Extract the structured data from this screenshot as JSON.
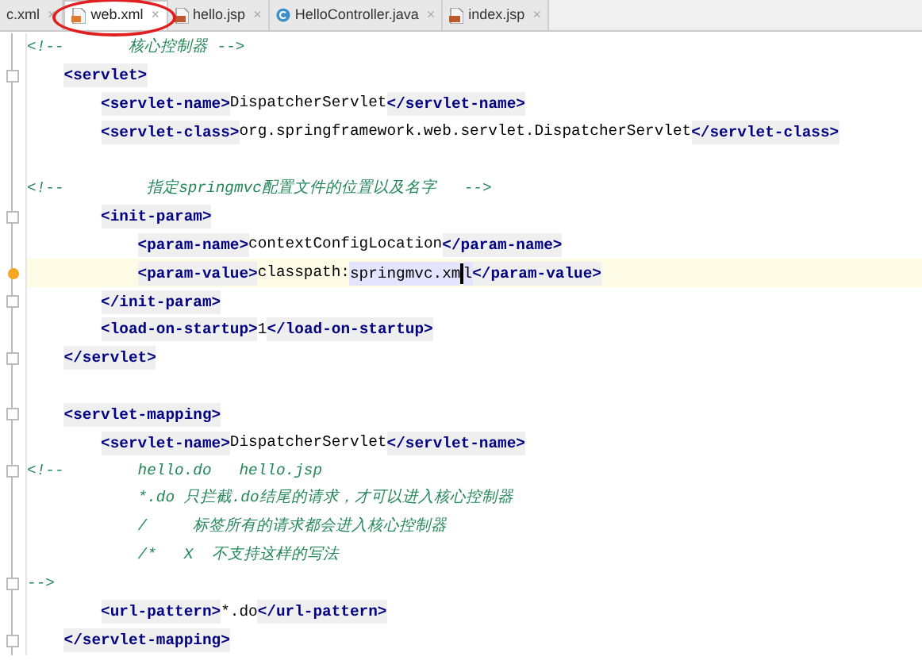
{
  "tabs": [
    {
      "label": "c.xml",
      "close": "×",
      "kind": "plain",
      "selected": false,
      "circled": false
    },
    {
      "label": "web.xml",
      "close": "×",
      "kind": "xml",
      "selected": true,
      "circled": true
    },
    {
      "label": "hello.jsp",
      "close": "×",
      "kind": "jsp",
      "selected": false,
      "circled": false
    },
    {
      "label": "HelloController.java",
      "close": "×",
      "kind": "class",
      "selected": false,
      "circled": false
    },
    {
      "label": "index.jsp",
      "close": "×",
      "kind": "jsp",
      "selected": false,
      "circled": false
    }
  ],
  "lines": [
    {
      "fold": false,
      "current": false,
      "segments": [
        {
          "kind": "comment",
          "text": "<!--       核心控制器 -->"
        }
      ]
    },
    {
      "fold": true,
      "current": false,
      "segments": [
        {
          "kind": "tag",
          "text": "    <servlet>"
        }
      ]
    },
    {
      "fold": false,
      "current": false,
      "segments": [
        {
          "kind": "tag",
          "text": "        <servlet-name>"
        },
        {
          "kind": "text",
          "text": "DispatcherServlet"
        },
        {
          "kind": "tag",
          "text": "</servlet-name>"
        }
      ]
    },
    {
      "fold": false,
      "current": false,
      "segments": [
        {
          "kind": "tag",
          "text": "        <servlet-class>"
        },
        {
          "kind": "text",
          "text": "org.springframework.web.servlet.DispatcherServlet"
        },
        {
          "kind": "tag",
          "text": "</servlet-class>"
        }
      ]
    },
    {
      "fold": false,
      "current": false
    },
    {
      "fold": false,
      "current": false,
      "segments": [
        {
          "kind": "comment",
          "text": "<!--         指定springmvc配置文件的位置以及名字   -->"
        }
      ]
    },
    {
      "fold": true,
      "current": false,
      "segments": [
        {
          "kind": "tag",
          "text": "        <init-param>"
        }
      ]
    },
    {
      "fold": false,
      "current": false,
      "segments": [
        {
          "kind": "tag",
          "text": "            <param-name>"
        },
        {
          "kind": "text",
          "text": "contextConfigLocation"
        },
        {
          "kind": "tag",
          "text": "</param-name>"
        }
      ]
    },
    {
      "fold": false,
      "current": true,
      "segments": [
        {
          "kind": "tag",
          "text": "            <param-value>"
        },
        {
          "kind": "text",
          "text": "classpath:"
        },
        {
          "kind": "highlight",
          "text": "springmvc.xm"
        },
        {
          "kind": "caret"
        },
        {
          "kind": "highlight",
          "text": "l"
        },
        {
          "kind": "tag",
          "text": "</param-value>"
        }
      ]
    },
    {
      "fold": true,
      "current": false,
      "segments": [
        {
          "kind": "tag",
          "text": "        </init-param>"
        }
      ]
    },
    {
      "fold": false,
      "current": false,
      "segments": [
        {
          "kind": "tag",
          "text": "        <load-on-startup>"
        },
        {
          "kind": "text",
          "text": "1"
        },
        {
          "kind": "tag",
          "text": "</load-on-startup>"
        }
      ]
    },
    {
      "fold": true,
      "current": false,
      "segments": [
        {
          "kind": "tag",
          "text": "    </servlet>"
        }
      ]
    },
    {
      "fold": false,
      "current": false
    },
    {
      "fold": true,
      "current": false,
      "segments": [
        {
          "kind": "tag",
          "text": "    <servlet-mapping>"
        }
      ]
    },
    {
      "fold": false,
      "current": false,
      "segments": [
        {
          "kind": "tag",
          "text": "        <servlet-name>"
        },
        {
          "kind": "text",
          "text": "DispatcherServlet"
        },
        {
          "kind": "tag",
          "text": "</servlet-name>"
        }
      ]
    },
    {
      "fold": true,
      "current": false,
      "segments": [
        {
          "kind": "comment",
          "text": "<!--        hello.do   hello.jsp"
        }
      ]
    },
    {
      "fold": false,
      "current": false,
      "segments": [
        {
          "kind": "comment",
          "text": "            *.do 只拦截.do结尾的请求，才可以进入核心控制器"
        }
      ]
    },
    {
      "fold": false,
      "current": false,
      "segments": [
        {
          "kind": "comment",
          "text": "            /     标签所有的请求都会进入核心控制器"
        }
      ]
    },
    {
      "fold": false,
      "current": false,
      "segments": [
        {
          "kind": "comment",
          "text": "            /*   X  不支持这样的写法"
        }
      ]
    },
    {
      "fold": true,
      "current": false,
      "segments": [
        {
          "kind": "comment",
          "text": "-->"
        }
      ]
    },
    {
      "fold": false,
      "current": false,
      "segments": [
        {
          "kind": "tag",
          "text": "        <url-pattern>"
        },
        {
          "kind": "text",
          "text": "*.do"
        },
        {
          "kind": "tag",
          "text": "</url-pattern>"
        }
      ]
    },
    {
      "fold": true,
      "current": false,
      "segments": [
        {
          "kind": "tag",
          "text": "    </servlet-mapping>"
        }
      ]
    }
  ]
}
